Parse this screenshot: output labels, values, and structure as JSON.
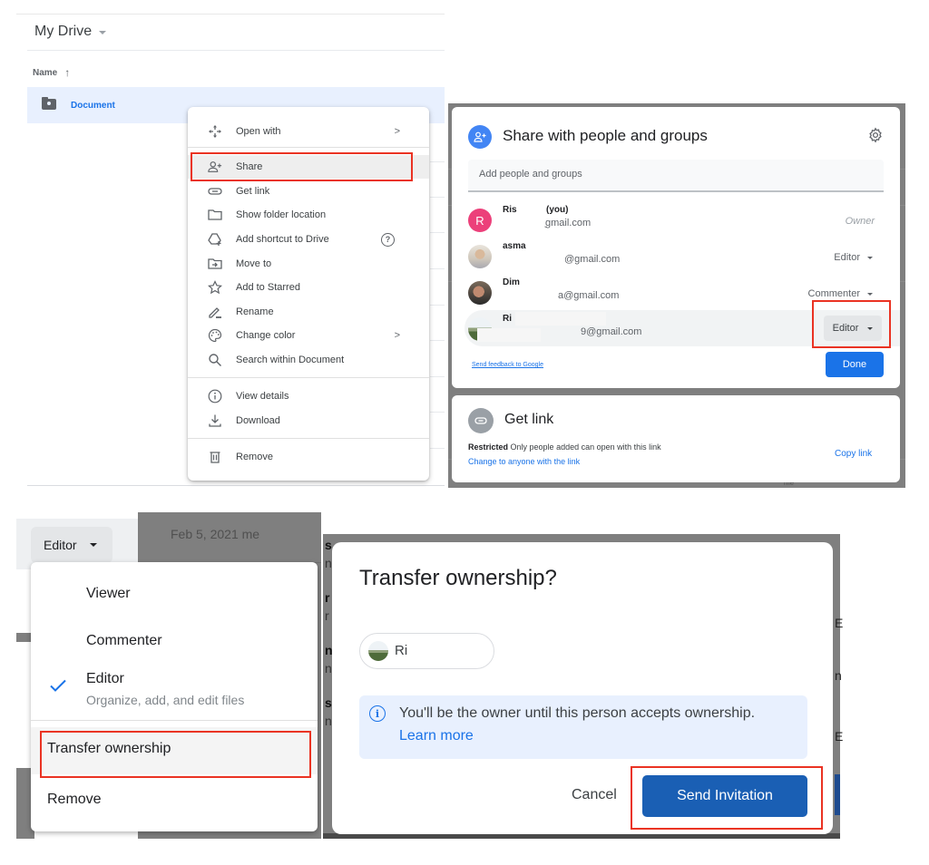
{
  "drive": {
    "location": "My Drive",
    "name_column": "Name",
    "sort_arrow": "↑",
    "file_name": "Document",
    "context_menu": {
      "items": [
        {
          "label": "Open with",
          "icon": "open-with-icon",
          "submenu": true
        },
        {
          "label": "Share",
          "icon": "person-add-icon",
          "highlighted": true
        },
        {
          "label": "Get link",
          "icon": "link-icon"
        },
        {
          "label": "Show folder location",
          "icon": "folder-icon"
        },
        {
          "label": "Add shortcut to Drive",
          "icon": "drive-shortcut-icon",
          "help": true
        },
        {
          "label": "Move to",
          "icon": "move-to-icon"
        },
        {
          "label": "Add to Starred",
          "icon": "star-icon"
        },
        {
          "label": "Rename",
          "icon": "pencil-icon"
        },
        {
          "label": "Change color",
          "icon": "palette-icon",
          "submenu": true
        },
        {
          "label": "Search within Document",
          "icon": "search-icon"
        },
        {
          "label": "View details",
          "icon": "info-icon"
        },
        {
          "label": "Download",
          "icon": "download-icon"
        },
        {
          "label": "Remove",
          "icon": "trash-icon"
        }
      ],
      "help_glyph": "?",
      "submenu_glyph": ">"
    }
  },
  "share_dialog": {
    "title": "Share with people and groups",
    "add_placeholder": "Add people and groups",
    "people": [
      {
        "name": "Ris",
        "suffix": "(you)",
        "email": "ͅgmail.com",
        "role": "Owner",
        "avatar_letter": "R",
        "avatar_color": "#ec407a"
      },
      {
        "name": "asma",
        "email": "@gmail.com",
        "role": "Editor"
      },
      {
        "name": "Dim",
        "email": "a@gmail.com",
        "role": "Commenter"
      },
      {
        "name": "Ri",
        "email": "9@gmail.com",
        "role": "Editor",
        "selected": true
      }
    ],
    "feedback_link": "Send feedback to Google",
    "done_label": "Done"
  },
  "get_link": {
    "title": "Get link",
    "restricted_label": "Restricted",
    "restricted_desc": "Only people added can open with this link",
    "change_link": "Change to anyone with the link",
    "copy_link": "Copy link"
  },
  "background_text": {
    "owner_short": "me",
    "modified": "Feb 5, 2021  me"
  },
  "role_menu": {
    "current_role": "Editor",
    "options": [
      {
        "label": "Viewer"
      },
      {
        "label": "Commenter"
      },
      {
        "label": "Editor",
        "description": "Organize, add, and edit files",
        "checked": true
      }
    ],
    "transfer_label": "Transfer ownership",
    "remove_label": "Remove"
  },
  "transfer_dialog": {
    "title": "Transfer ownership?",
    "recipient": "Ri",
    "info_text": "You'll be the owner until this person accepts ownership.",
    "learn_more": "Learn more",
    "cancel_label": "Cancel",
    "send_label": "Send Invitation"
  },
  "colors": {
    "accent": "#1a73e8",
    "highlight_box": "#ea3323",
    "send_button": "#1a5fb4"
  }
}
